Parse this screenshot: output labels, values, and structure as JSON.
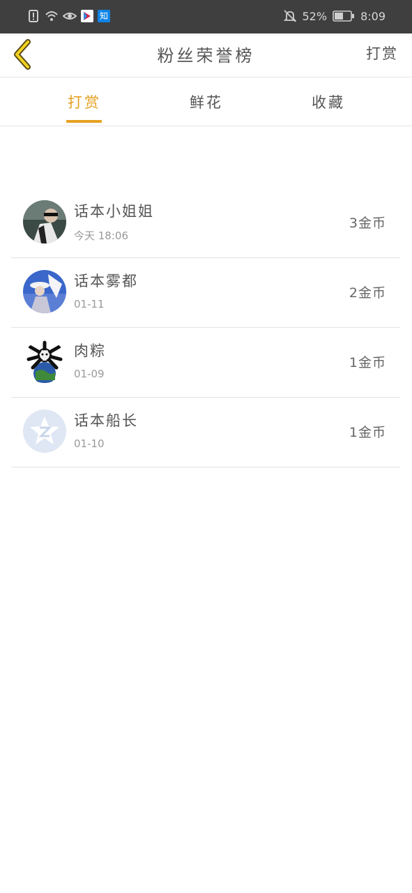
{
  "status_bar": {
    "icons": [
      "alert-icon",
      "wifi-icon",
      "eye-icon",
      "app-icon",
      "zhihu-icon",
      "mute-icon",
      "battery-icon"
    ],
    "zhihu_label": "知",
    "battery_percent": "52%",
    "time": "8:09"
  },
  "nav": {
    "title": "粉丝荣誉榜",
    "action": "打赏"
  },
  "tabs": [
    {
      "label": "打赏",
      "active": true
    },
    {
      "label": "鲜花",
      "active": false
    },
    {
      "label": "收藏",
      "active": false
    }
  ],
  "colors": {
    "accent": "#e6a121",
    "status_bar": "#3f3f3f"
  },
  "list": [
    {
      "name": "话本小姐姐",
      "date": "今天 18:06",
      "amount": "3金币"
    },
    {
      "name": "话本雾都",
      "date": "01-11",
      "amount": "2金币"
    },
    {
      "name": "肉粽",
      "date": "01-09",
      "amount": "1金币"
    },
    {
      "name": "话本船长",
      "date": "01-10",
      "amount": "1金币"
    }
  ]
}
